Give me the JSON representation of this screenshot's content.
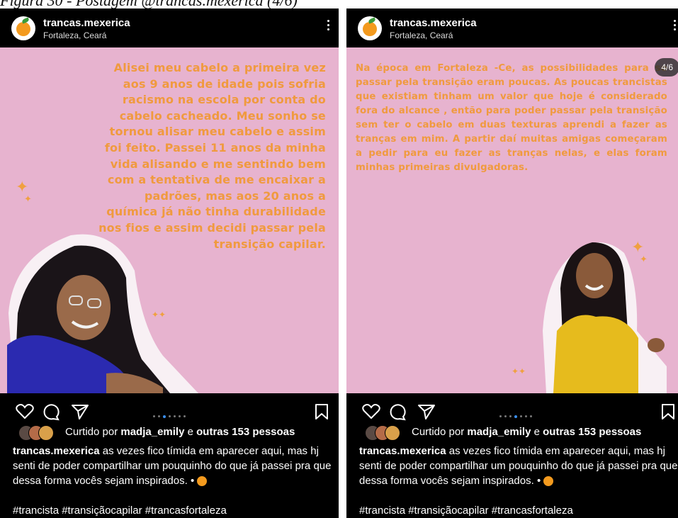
{
  "figure_caption": "Figura 30 - Postagem @trancas.mexerica (4/6)",
  "posts": [
    {
      "username": "trancas.mexerica",
      "location": "Fortaleza, Ceará",
      "photo_text": "Alisei meu cabelo a primeira vez aos 9 anos de idade pois sofria racismo na escola por conta do cabelo cacheado. Meu sonho se tornou alisar meu cabelo e assim foi feito. Passei 11 anos da minha vida alisando e me sentindo bem com a tentativa de me encaixar a padrões, mas aos 20 anos a química já não tinha durabilidade nos fios e assim decidi passar pela transição capilar.",
      "counter": "",
      "liked_prefix": "Curtido por",
      "liked_user": "madja_emily",
      "liked_joiner": "e",
      "liked_others": "outras 153 pessoas",
      "caption_user": "trancas.mexerica",
      "caption_text": "as vezes fico tímida em aparecer aqui, mas hj senti de poder compartilhar um pouquinho do que já passei pra que dessa forma vocês sejam inspirados. •",
      "hashtags": "#trancista #transiçãocapilar #trancasfortaleza",
      "active_dot": 3
    },
    {
      "username": "trancas.mexerica",
      "location": "Fortaleza, Ceará",
      "photo_text": "Na época  em Fortaleza -Ce, as possibilidades para se passar pela transição eram poucas. As poucas trancistas que existiam tinham um valor que hoje é considerado fora do alcance , então para poder passar pela transição sem ter o cabelo em duas texturas aprendi a fazer as tranças em mim. A partir daí muitas amigas começaram a pedir para eu fazer as tranças nelas, e elas foram minhas primeiras divulgadoras.",
      "counter": "4/6",
      "liked_prefix": "Curtido por",
      "liked_user": "madja_emily",
      "liked_joiner": "e",
      "liked_others": "outras 153 pessoas",
      "caption_user": "trancas.mexerica",
      "caption_text": "as vezes fico tímida em aparecer aqui, mas hj senti de poder compartilhar um pouquinho do que já passei pra que dessa forma vocês sejam inspirados. •",
      "hashtags": "#trancista #transiçãocapilar #trancasfortaleza",
      "active_dot": 4
    }
  ],
  "icons": [
    "heart-icon",
    "comment-icon",
    "share-icon",
    "bookmark-icon",
    "more-options-icon",
    "orange-emoji-icon"
  ],
  "colors": {
    "background": "#000000",
    "photo_bg": "#e7b3cf",
    "photo_text": "#f09a3e",
    "dot_active": "#3a8ff0"
  }
}
